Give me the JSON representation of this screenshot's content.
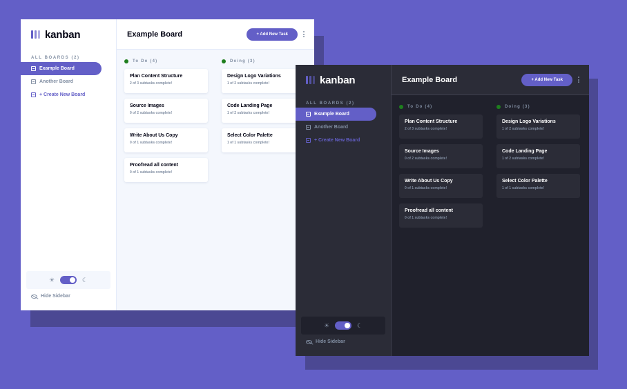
{
  "app": {
    "name": "kanban",
    "colors": {
      "background": "#635FC7",
      "accent": "#635FC7",
      "todo_dot": "#1E7E1E",
      "doing_dot": "#1E7E1E",
      "muted_text": "#828FA3"
    }
  },
  "light": {
    "theme": "light",
    "sidebar": {
      "boards_label": "ALL BOARDS (2)",
      "boards": [
        {
          "label": "Example Board",
          "active": true,
          "icon": "board-icon"
        },
        {
          "label": "Another Board",
          "active": false,
          "icon": "board-icon"
        }
      ],
      "create_label": "+ Create New Board",
      "theme_toggle": {
        "light_icon": "sun-icon",
        "dark_icon": "moon-icon",
        "glyph_light": "☀",
        "glyph_dark": "☾"
      },
      "hide_label": "Hide Sidebar"
    },
    "header": {
      "title": "Example Board",
      "add_task_label": "+ Add New Task"
    },
    "columns": [
      {
        "name": "To Do (4)",
        "tasks": [
          {
            "title": "Plan Content Structure",
            "subtasks": "2 of 3 subtasks complete!"
          },
          {
            "title": "Source Images",
            "subtasks": "0 of 2 subtasks complete!"
          },
          {
            "title": "Write About Us Copy",
            "subtasks": "0 of 1 subtasks complete!"
          },
          {
            "title": "Proofread all content",
            "subtasks": "0 of 1 subtasks complete!"
          }
        ]
      },
      {
        "name": "Doing (3)",
        "tasks": [
          {
            "title": "Design Logo Variations",
            "subtasks": "1 of 2 subtasks complete!"
          },
          {
            "title": "Code Landing Page",
            "subtasks": "1 of 2 subtasks complete!"
          },
          {
            "title": "Select Color Palette",
            "subtasks": "1 of 1 subtasks complete!"
          }
        ]
      }
    ]
  },
  "dark": {
    "theme": "dark",
    "sidebar": {
      "boards_label": "ALL BOARDS (2)",
      "boards": [
        {
          "label": "Example Board",
          "active": true,
          "icon": "board-icon"
        },
        {
          "label": "Another Board",
          "active": false,
          "icon": "board-icon"
        }
      ],
      "create_label": "+ Create New Board",
      "theme_toggle": {
        "light_icon": "sun-icon",
        "dark_icon": "moon-icon",
        "glyph_light": "☀",
        "glyph_dark": "☾"
      },
      "hide_label": "Hide Sidebar"
    },
    "header": {
      "title": "Example Board",
      "add_task_label": "+ Add New Task"
    },
    "columns": [
      {
        "name": "To Do (4)",
        "tasks": [
          {
            "title": "Plan Content Structure",
            "subtasks": "2 of 3 subtasks complete!"
          },
          {
            "title": "Source Images",
            "subtasks": "0 of 2 subtasks complete!"
          },
          {
            "title": "Write About Us Copy",
            "subtasks": "0 of 1 subtasks complete!"
          },
          {
            "title": "Proofread all content",
            "subtasks": "0 of 1 subtasks complete!"
          }
        ]
      },
      {
        "name": "Doing (3)",
        "tasks": [
          {
            "title": "Design Logo Variations",
            "subtasks": "1 of 2 subtasks complete!"
          },
          {
            "title": "Code Landing Page",
            "subtasks": "1 of 2 subtasks complete!"
          },
          {
            "title": "Select Color Palette",
            "subtasks": "1 of 1 subtasks complete!"
          }
        ]
      }
    ]
  }
}
